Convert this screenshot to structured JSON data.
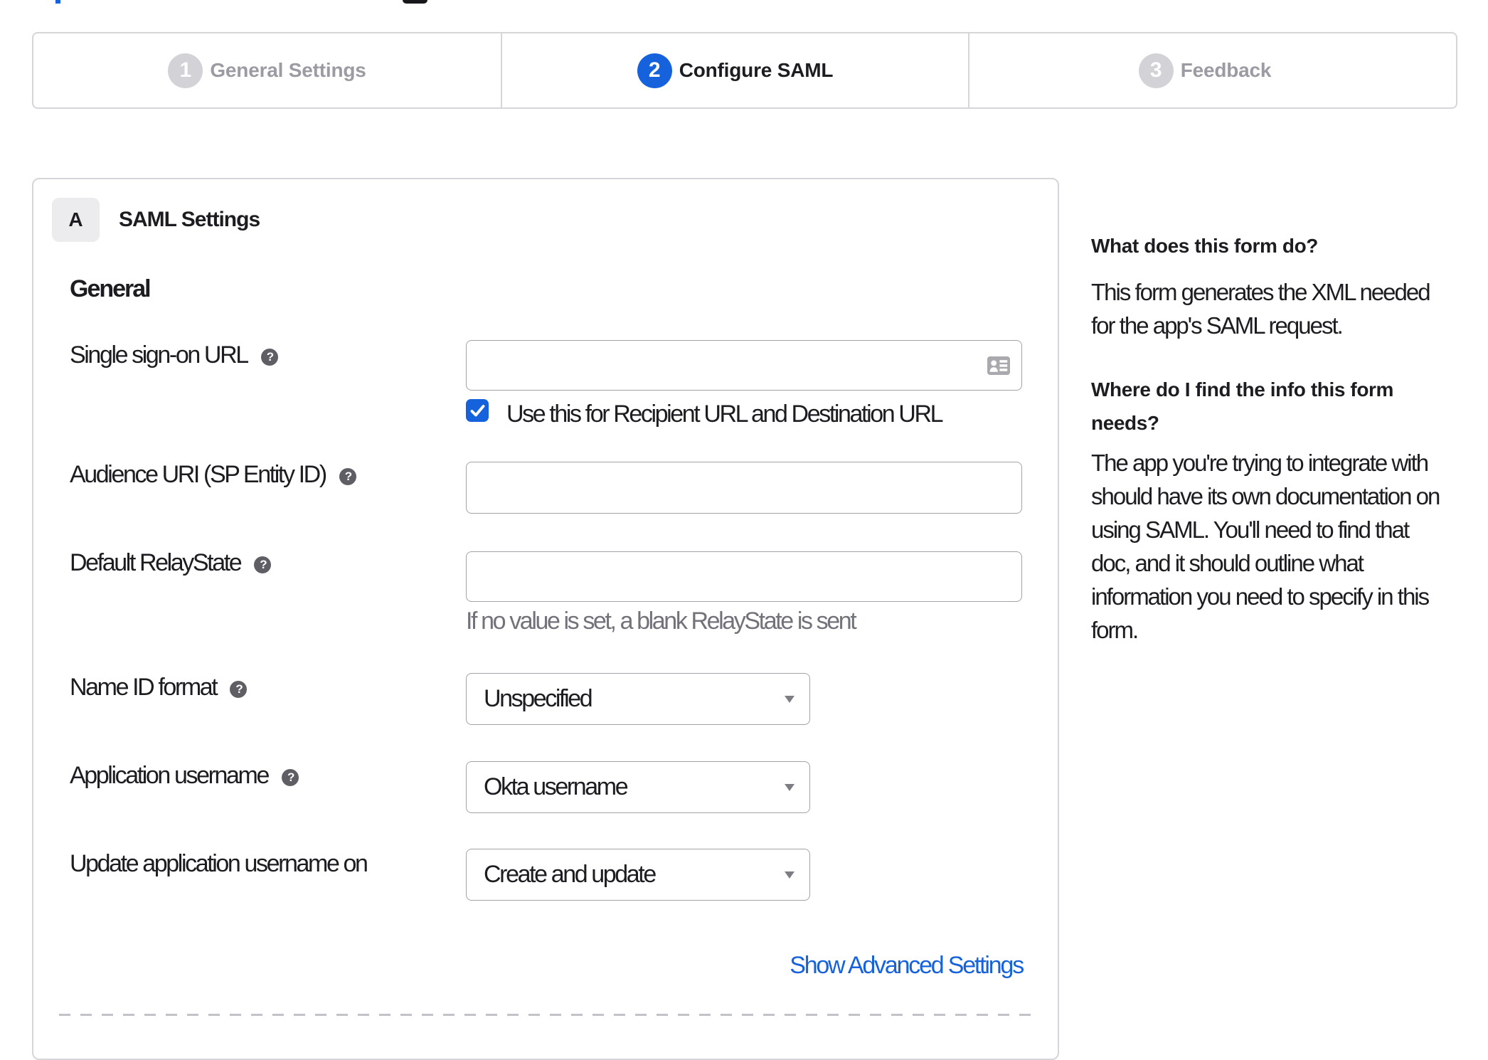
{
  "accent_color": "#1662dd",
  "stepper": {
    "steps": [
      {
        "number": "1",
        "label": "General Settings",
        "state": "inactive"
      },
      {
        "number": "2",
        "label": "Configure SAML",
        "state": "active"
      },
      {
        "number": "3",
        "label": "Feedback",
        "state": "inactive"
      }
    ]
  },
  "panel": {
    "section_badge": "A",
    "section_title": "SAML Settings",
    "group_heading": "General",
    "fields": [
      {
        "label": "Single sign-on URL",
        "type": "input",
        "value": "",
        "icon": "contact-card"
      },
      {
        "label": "Audience URI (SP Entity ID)",
        "type": "input",
        "value": ""
      },
      {
        "label": "Default RelayState",
        "type": "input",
        "value": "",
        "helper": "If no value is set, a blank RelayState is sent"
      },
      {
        "label": "Name ID format",
        "type": "select",
        "value": "Unspecified"
      },
      {
        "label": "Application username",
        "type": "select",
        "value": "Okta username"
      },
      {
        "label": "Update application username on",
        "type": "select",
        "value": "Create and update"
      }
    ],
    "checkbox": {
      "checked": true,
      "label": "Use this for Recipient URL and Destination URL"
    },
    "advanced_link": "Show Advanced Settings"
  },
  "help": {
    "heading1": "What does this form do?",
    "para1": [
      "This form generates the XML needed",
      "for the app's SAML request."
    ],
    "heading2": [
      "Where do I find the info this form",
      "needs?"
    ],
    "para2": [
      "The app you're trying to integrate with",
      "should have its own documentation on",
      "using SAML. You'll need to find that",
      "doc, and it should outline what",
      "information you need to specify in this",
      "form."
    ]
  }
}
